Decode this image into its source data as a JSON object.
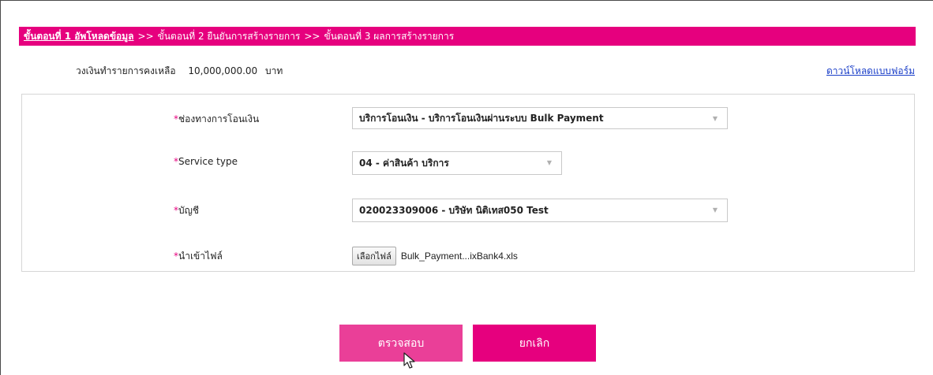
{
  "steps": [
    {
      "label": "ขั้นตอนที่ 1 อัพโหลดข้อมูล"
    },
    {
      "label": "ขั้นตอนที่ 2 ยืนยันการสร้างรายการ"
    },
    {
      "label": "ขั้นตอนที่ 3 ผลการสร้างรายการ"
    }
  ],
  "step_separator": ">>",
  "balance": {
    "label": "วงเงินทำรายการคงเหลือ",
    "amount": "10,000,000.00",
    "unit": "บาท"
  },
  "download_form_link": "ดาวน์โหลดแบบฟอร์ม",
  "form": {
    "required_mark": "*",
    "channel": {
      "label": "ช่องทางการโอนเงิน",
      "value": "บริการโอนเงิน - บริการโอนเงินผ่านระบบ Bulk Payment"
    },
    "service_type": {
      "label": "Service type",
      "value": "04 - ค่าสินค้า บริการ"
    },
    "account": {
      "label": "บัญชี",
      "value": "020023309006 - บริษัท นิติเทส050 Test"
    },
    "import_file": {
      "label": "นำเข้าไฟล์",
      "button_label": "เลือกไฟล์",
      "file_name": "Bulk_Payment...ixBank4.xls"
    }
  },
  "buttons": {
    "check_label": "ตรวจสอบ",
    "cancel_label": "ยกเลิก"
  },
  "colors": {
    "brand": "#e6007e",
    "button_hover": "#ea3f98",
    "link": "#1a3ec8"
  }
}
